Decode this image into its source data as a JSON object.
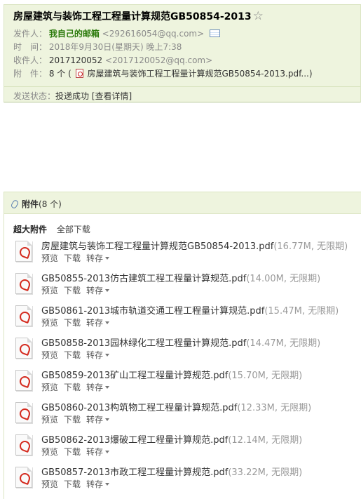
{
  "mail": {
    "subject": "房屋建筑与装饰工程工程量计算规范GB50854-2013",
    "star": "☆",
    "sender_label": "发件人：",
    "sender_name": "我自己的邮箱",
    "sender_addr": "<292616054@qq.com>",
    "time_label": "时　间：",
    "time_value": "2018年9月30日(星期天) 晚上7:38",
    "recipient_label": "收件人：",
    "recipient_name": "2017120052",
    "recipient_addr": "<2017120052@qq.com>",
    "attach_label": "附　件：",
    "attach_count": "8 个",
    "attach_open": "(",
    "attach_first": "房屋建筑与装饰工程工程量计算规范GB50854-2013.pdf...)",
    "status_label": "发送状态：",
    "status_value": "投递成功",
    "status_detail": "[查看详情]"
  },
  "attachments": {
    "title": "附件",
    "count": "(8 个)",
    "super_label": "超大附件",
    "download_all": "全部下载",
    "actions": {
      "preview": "预览",
      "download": "下载",
      "save": "转存"
    },
    "files": [
      {
        "name": "房屋建筑与装饰工程工程量计算规范GB50854-2013.pdf",
        "meta": "(16.77M, 无限期)"
      },
      {
        "name": "GB50855-2013仿古建筑工程工程量计算规范.pdf",
        "meta": "(14.00M, 无限期)"
      },
      {
        "name": "GB50861-2013城市轨道交通工程工程量计算规范.pdf",
        "meta": "(15.47M, 无限期)"
      },
      {
        "name": "GB50858-2013园林绿化工程工程量计算规范.pdf",
        "meta": "(14.47M, 无限期)"
      },
      {
        "name": "GB50859-2013矿山工程工程量计算规范.pdf",
        "meta": "(15.70M, 无限期)"
      },
      {
        "name": "GB50860-2013构筑物工程工程量计算规范.pdf",
        "meta": "(12.33M, 无限期)"
      },
      {
        "name": "GB50862-2013爆破工程工程量计算规范.pdf",
        "meta": "(12.14M, 无限期)"
      },
      {
        "name": "GB50857-2013市政工程工程量计算规范.pdf",
        "meta": "(33.22M, 无限期)"
      }
    ]
  }
}
